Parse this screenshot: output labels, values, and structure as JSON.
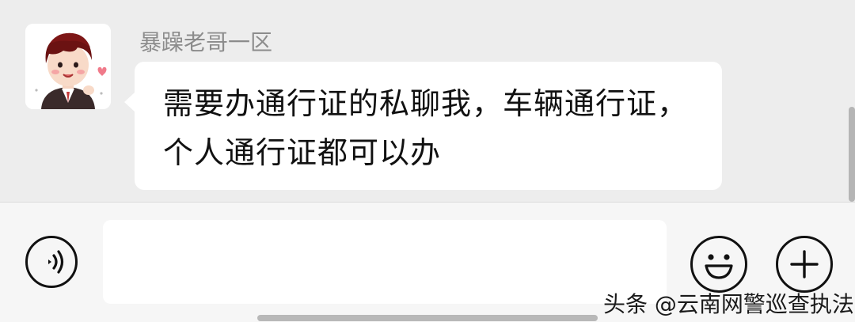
{
  "message": {
    "sender_name": "暴躁老哥一区",
    "text": "需要办通行证的私聊我，车辆通行证，个人通行证都可以办"
  },
  "input_bar": {
    "input_value": "",
    "voice_icon": "voice-icon",
    "emoji_icon": "emoji-icon",
    "plus_icon": "plus-icon"
  },
  "watermark": {
    "text": "头条 @云南网警巡查执法"
  },
  "colors": {
    "chat_background": "#ededed",
    "bubble_background": "#ffffff",
    "input_bar_background": "#f6f6f6",
    "sender_name": "#8c8c8c"
  }
}
